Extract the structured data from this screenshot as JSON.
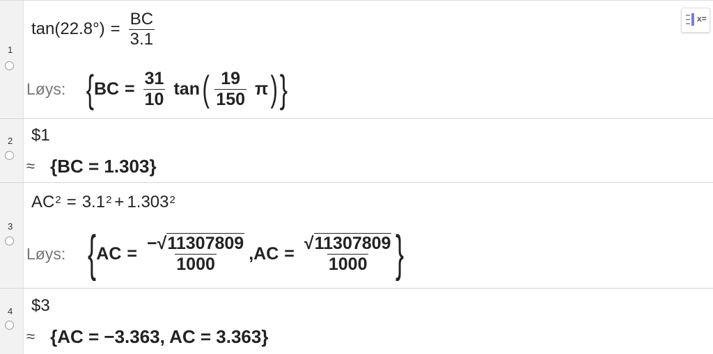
{
  "toggle": {
    "icon": "algebra-toggle-icon",
    "label": "x="
  },
  "rows": [
    {
      "num": "1",
      "input": {
        "lhs": "tan(22.8°)",
        "eq": "=",
        "num": "BC",
        "den": "3.1"
      },
      "output": {
        "label": "Løys:",
        "open": "{",
        "var": "BC",
        "eq": "=",
        "f1_num": "31",
        "f1_den": "10",
        "fn": "tan",
        "lparen": "(",
        "f2_num": "19",
        "f2_den": "150",
        "pi": "π",
        "rparen": ")",
        "close": "}"
      }
    },
    {
      "num": "2",
      "input": {
        "text": "$1"
      },
      "output": {
        "approx": "≈",
        "text": "{BC = 1.303}"
      }
    },
    {
      "num": "3",
      "input": {
        "base1": "AC",
        "exp1": "2",
        "eq": "=",
        "base2": "3.1",
        "exp2": "2",
        "plus": "+",
        "base3": "1.303",
        "exp3": "2"
      },
      "output": {
        "label": "Løys:",
        "open": "{",
        "var1": "AC",
        "eq": "=",
        "neg": "−",
        "rad": "11307809",
        "den": "1000",
        "comma": ",",
        "var2": "AC",
        "rad2": "11307809",
        "den2": "1000",
        "close": "}"
      }
    },
    {
      "num": "4",
      "input": {
        "text": "$3"
      },
      "output": {
        "approx": "≈",
        "text": "{AC = −3.363, AC = 3.363}"
      }
    }
  ]
}
